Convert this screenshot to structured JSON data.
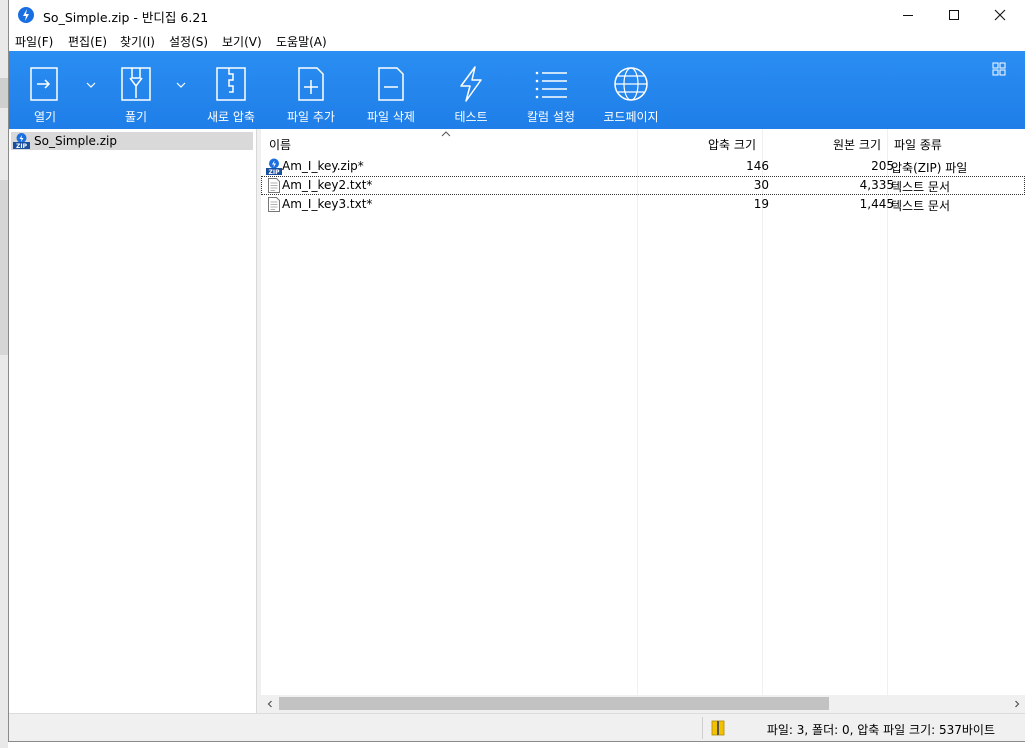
{
  "window": {
    "title": "So_Simple.zip - 반디집 6.21"
  },
  "menu": {
    "items": [
      {
        "label": "파일(F)"
      },
      {
        "label": "편집(E)"
      },
      {
        "label": "찾기(I)"
      },
      {
        "label": "설정(S)"
      },
      {
        "label": "보기(V)"
      },
      {
        "label": "도움말(A)"
      }
    ]
  },
  "toolbar": {
    "open": "열기",
    "extract": "풀기",
    "new_archive": "새로 압축",
    "add_file": "파일 추가",
    "delete_file": "파일 삭제",
    "test": "테스트",
    "column_settings": "칼럼 설정",
    "codepage": "코드페이지"
  },
  "tree": {
    "root": "So_Simple.zip"
  },
  "columns": {
    "name": "이름",
    "compressed": "압축 크기",
    "original": "원본 크기",
    "type": "파일 종류"
  },
  "files": [
    {
      "name": "Am_I_key.zip*",
      "compressed": "146",
      "original": "205",
      "type": "압축(ZIP) 파일",
      "icon": "zip-file-icon"
    },
    {
      "name": "Am_I_key2.txt*",
      "compressed": "30",
      "original": "4,335",
      "type": "텍스트 문서",
      "icon": "text-file-icon"
    },
    {
      "name": "Am_I_key3.txt*",
      "compressed": "19",
      "original": "1,445",
      "type": "텍스트 문서",
      "icon": "text-file-icon"
    }
  ],
  "status": {
    "text": "파일: 3, 폴더: 0, 압축 파일 크기: 537바이트"
  },
  "colors": {
    "toolbar_blue": "#1f7ee8",
    "selection_gray": "#d9d9d9"
  }
}
